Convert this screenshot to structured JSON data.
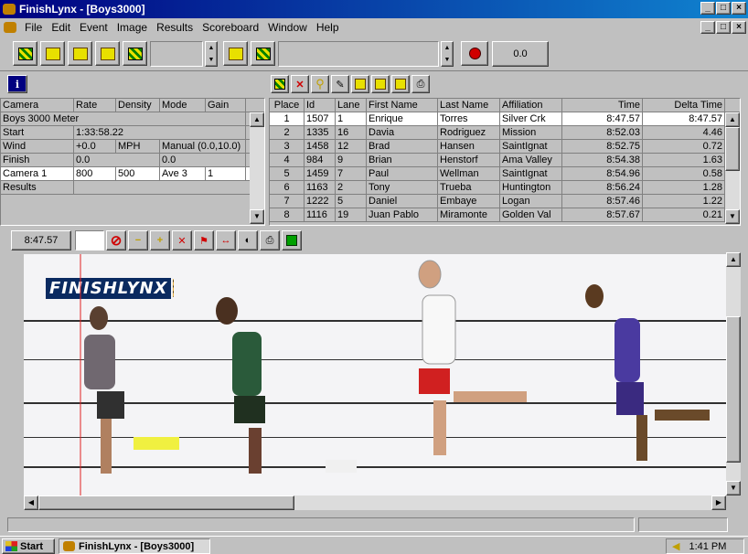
{
  "window": {
    "title": "FinishLynx - [Boys3000]"
  },
  "menu": [
    "File",
    "Edit",
    "Event",
    "Image",
    "Results",
    "Scoreboard",
    "Window",
    "Help"
  ],
  "toolbar": {
    "time_readout": "0.0"
  },
  "camera_grid": {
    "headers": [
      "Camera",
      "Rate",
      "Density",
      "Mode",
      "Gain"
    ],
    "event_name": "Boys 3000 Meter",
    "rows": [
      {
        "label": "Start",
        "c1": "1:33:58.22",
        "c2": "",
        "c3": "",
        "c4": ""
      },
      {
        "label": "Wind",
        "c1": "+0.0",
        "c2": "MPH",
        "c3": "Manual (0.0,10.0)",
        "c4": ""
      },
      {
        "label": "Finish",
        "c1": "0.0",
        "c2": "",
        "c3": "0.0",
        "c4": ""
      },
      {
        "label": "Camera 1",
        "c1": "800",
        "c2": "500",
        "c3": "Ave 3",
        "c4": "1"
      },
      {
        "label": "Results",
        "c1": "",
        "c2": "",
        "c3": "",
        "c4": ""
      }
    ]
  },
  "results": {
    "headers": [
      "Place",
      "Id",
      "Lane",
      "First Name",
      "Last Name",
      "Affiliation",
      "Time",
      "Delta Time"
    ],
    "rows": [
      [
        "1",
        "1507",
        "1",
        "Enrique",
        "Torres",
        "Silver Crk",
        "8:47.57",
        "8:47.57"
      ],
      [
        "2",
        "1335",
        "16",
        "Davia",
        "Rodriguez",
        "Mission",
        "8:52.03",
        "4.46"
      ],
      [
        "3",
        "1458",
        "12",
        "Brad",
        "Hansen",
        "SaintIgnat",
        "8:52.75",
        "0.72"
      ],
      [
        "4",
        "984",
        "9",
        "Brian",
        "Henstorf",
        "Ama Valley",
        "8:54.38",
        "1.63"
      ],
      [
        "5",
        "1459",
        "7",
        "Paul",
        "Wellman",
        "SaintIgnat",
        "8:54.96",
        "0.58"
      ],
      [
        "6",
        "1163",
        "2",
        "Tony",
        "Trueba",
        "Huntington",
        "8:56.24",
        "1.28"
      ],
      [
        "7",
        "1222",
        "5",
        "Daniel",
        "Embaye",
        "Logan",
        "8:57.46",
        "1.22"
      ],
      [
        "8",
        "1116",
        "19",
        "Juan Pablo",
        "Miramonte",
        "Golden Val",
        "8:57.67",
        "0.21"
      ]
    ]
  },
  "image_toolbar": {
    "time": "8:47.57"
  },
  "finish_image": {
    "logo_text": "FINISHLYNX"
  },
  "taskbar": {
    "start_label": "Start",
    "task_label": "FinishLynx - [Boys3000]",
    "clock": "1:41 PM"
  }
}
